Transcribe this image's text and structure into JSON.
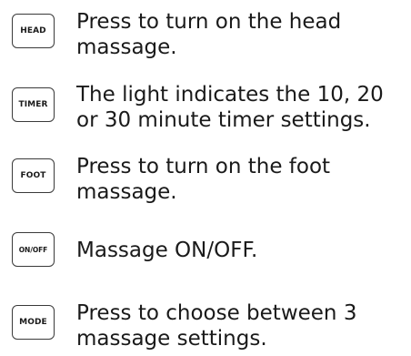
{
  "controls": [
    {
      "key_label": "HEAD",
      "description": "Press to turn on the head massage."
    },
    {
      "key_label": "TIMER",
      "description": "The light indicates the 10, 20 or 30 minute timer settings."
    },
    {
      "key_label": "FOOT",
      "description": "Press to turn on the foot massage."
    },
    {
      "key_label": "ON/OFF",
      "description": "Massage ON/OFF."
    },
    {
      "key_label": "MODE",
      "description": "Press to choose between 3 massage settings."
    }
  ]
}
